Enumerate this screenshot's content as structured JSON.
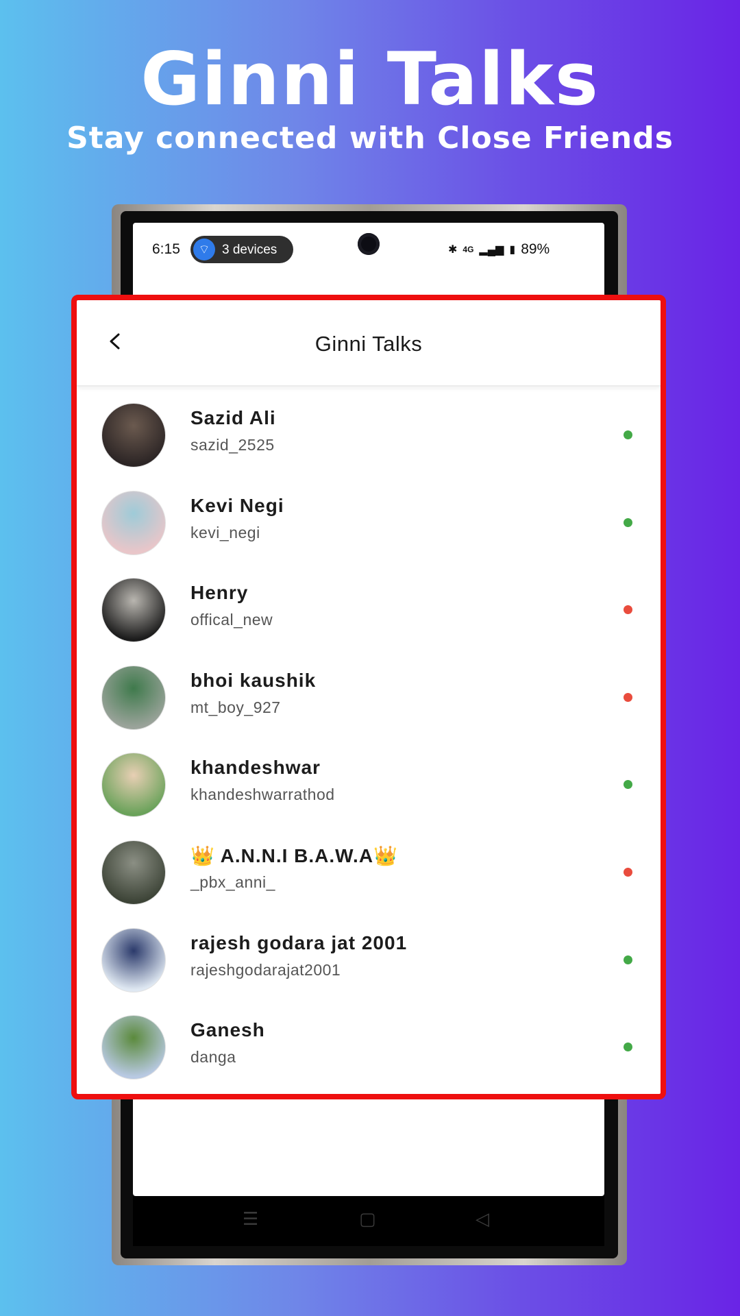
{
  "promo": {
    "title": "Ginni Talks",
    "subtitle": "Stay connected with Close Friends"
  },
  "status_bar": {
    "time": "6:15",
    "devices_label": "3 devices",
    "battery": "89%",
    "network": "4G"
  },
  "header": {
    "title": "Ginni Talks",
    "back_icon": "chevron-left-icon"
  },
  "colors": {
    "online": "#43a947",
    "offline": "#e94c3d",
    "highlight_border": "#ee0f0f"
  },
  "users": [
    {
      "name": "Sazid Ali",
      "handle": "sazid_2525",
      "status": "online",
      "avatar_colors": [
        "#2c2525",
        "#6b5a4f"
      ]
    },
    {
      "name": "Kevi Negi",
      "handle": "kevi_negi",
      "status": "online",
      "avatar_colors": [
        "#e9c6c9",
        "#9ecbd8"
      ]
    },
    {
      "name": "Henry",
      "handle": "offical_new",
      "status": "offline",
      "avatar_colors": [
        "#1c1c1c",
        "#b9b6b0"
      ]
    },
    {
      "name": "bhoi kaushik",
      "handle": "mt_boy_927",
      "status": "offline",
      "avatar_colors": [
        "#9aa39a",
        "#3f7a4c"
      ]
    },
    {
      "name": "khandeshwar",
      "handle": "khandeshwarrathod",
      "status": "online",
      "avatar_colors": [
        "#6aa25a",
        "#e8cfb4"
      ]
    },
    {
      "name": "👑 A.N.N.I  B.A.W.A👑",
      "handle": "_pbx_anni_",
      "status": "offline",
      "avatar_colors": [
        "#3d4437",
        "#8b8f84"
      ]
    },
    {
      "name": "rajesh godara jat 2001",
      "handle": "rajeshgodarajat2001",
      "status": "online",
      "avatar_colors": [
        "#dfe8f2",
        "#2b3a6b"
      ]
    },
    {
      "name": "Ganesh",
      "handle": "danga",
      "status": "online",
      "avatar_colors": [
        "#b8c9e2",
        "#5b8a3c"
      ]
    }
  ]
}
